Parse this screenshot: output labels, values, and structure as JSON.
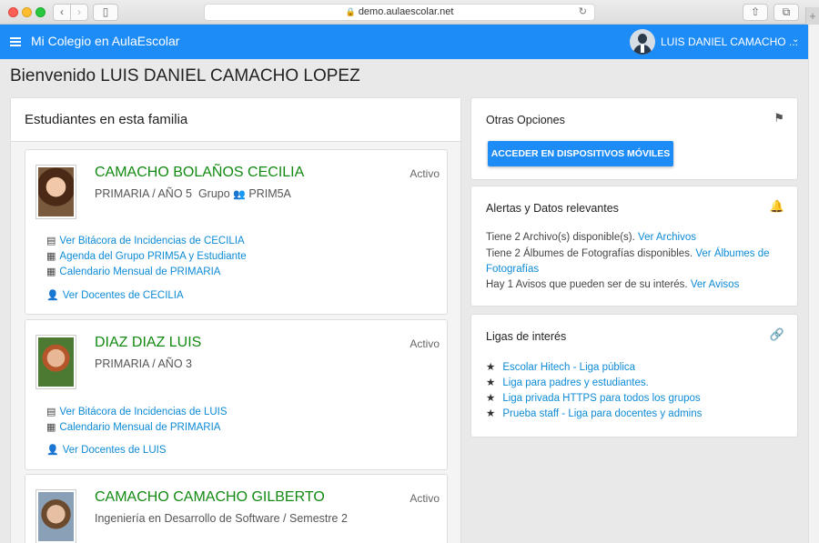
{
  "browser": {
    "url": "demo.aulaescolar.net"
  },
  "app": {
    "brand": "Mi Colegio en AulaEscolar",
    "user": "LUIS DANIEL CAMACHO ..."
  },
  "welcome": "Bienvenido LUIS DANIEL CAMACHO LOPEZ",
  "family": {
    "title": "Estudiantes en esta familia",
    "students": [
      {
        "name": "CAMACHO BOLAÑOS CECILIA",
        "level": "PRIMARIA / AÑO 5",
        "group_label": "Grupo",
        "group": "PRIM5A",
        "status": "Activo",
        "links": [
          "Ver Bitácora de Incidencias de CECILIA",
          "Agenda del Grupo PRIM5A y Estudiante",
          "Calendario Mensual de PRIMARIA",
          "Ver Docentes de CECILIA"
        ]
      },
      {
        "name": "DIAZ DIAZ LUIS",
        "level": "PRIMARIA / AÑO 3",
        "status": "Activo",
        "links": [
          "Ver Bitácora de Incidencias de LUIS",
          "Calendario Mensual de PRIMARIA",
          "Ver Docentes de LUIS"
        ]
      },
      {
        "name": "CAMACHO CAMACHO GILBERTO",
        "level": "Ingeniería en Desarrollo de Software / Semestre 2",
        "status": "Activo"
      }
    ]
  },
  "options": {
    "title": "Otras Opciones",
    "mobile_button": "ACCEDER EN DISPOSITIVOS MÓVILES"
  },
  "alerts": {
    "title": "Alertas y Datos relevantes",
    "files_text": "Tiene 2 Archivo(s) disponible(s).",
    "files_link": "Ver Archivos",
    "albums_text": "Tiene 2 Álbumes de Fotografías disponibles.",
    "albums_link_1": "Ver Álbumes de",
    "albums_link_2": "Fotografías",
    "notices_text": "Hay 1 Avisos que pueden ser de su interés.",
    "notices_link": "Ver Avisos"
  },
  "links": {
    "title": "Ligas de interés",
    "items": [
      "Escolar Hitech - Liga pública",
      "Liga para padres y estudiantes.",
      "Liga privada HTTPS para todos los grupos",
      "Prueba staff - Liga para docentes y admins"
    ]
  }
}
